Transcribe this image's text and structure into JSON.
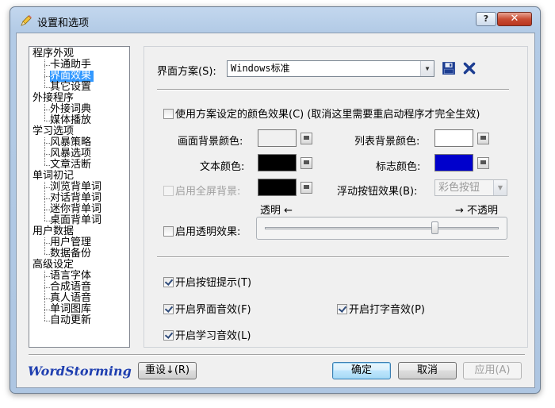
{
  "window": {
    "title": "设置和选项",
    "help_label": "?",
    "close_label": "✕"
  },
  "tree": {
    "items": [
      {
        "label": "程序外观",
        "level": 0
      },
      {
        "label": "卡通助手",
        "level": 1
      },
      {
        "label": "界面效果",
        "level": 1,
        "selected": true
      },
      {
        "label": "其它设置",
        "level": 1
      },
      {
        "label": "外接程序",
        "level": 0
      },
      {
        "label": "外接词典",
        "level": 1
      },
      {
        "label": "媒体播放",
        "level": 1
      },
      {
        "label": "学习选项",
        "level": 0
      },
      {
        "label": "风暴策略",
        "level": 1
      },
      {
        "label": "风暴选项",
        "level": 1
      },
      {
        "label": "文章活断",
        "level": 1
      },
      {
        "label": "单词初记",
        "level": 0
      },
      {
        "label": "浏览背单词",
        "level": 1
      },
      {
        "label": "对话背单词",
        "level": 1
      },
      {
        "label": "迷你背单词",
        "level": 1
      },
      {
        "label": "桌面背单词",
        "level": 1
      },
      {
        "label": "用户数据",
        "level": 0
      },
      {
        "label": "用户管理",
        "level": 1
      },
      {
        "label": "数据备份",
        "level": 1
      },
      {
        "label": "高级设定",
        "level": 0
      },
      {
        "label": "语言字体",
        "level": 1
      },
      {
        "label": "合成语音",
        "level": 1
      },
      {
        "label": "真人语音",
        "level": 1
      },
      {
        "label": "单词图库",
        "level": 1
      },
      {
        "label": "自动更新",
        "level": 1
      }
    ]
  },
  "panel": {
    "scheme_label": "界面方案(S):",
    "scheme_value": "Windows标准",
    "save_icon": "save-icon",
    "delete_icon": "delete-icon",
    "use_scheme_colors_label": "使用方案设定的颜色效果(C) (取消这里需要重启动程序才完全生效)",
    "use_scheme_colors_checked": false,
    "bg_color_label": "画面背景颜色:",
    "list_bg_color_label": "列表背景颜色:",
    "text_color_label": "文本颜色:",
    "mark_color_label": "标志颜色:",
    "fullscreen_bg_label": "启用全屏背景:",
    "fullscreen_bg_checked": false,
    "float_btn_label": "浮动按钮效果(B):",
    "float_btn_value": "彩色按钮",
    "transparent_label": "透明 ←",
    "opaque_label": "→ 不透明",
    "transparency_label": "启用透明效果:",
    "transparency_checked": false,
    "transparency_level": 0.73,
    "btn_tips_label": "开启按钮提示(T)",
    "btn_tips_checked": true,
    "ui_sound_label": "开启界面音效(F)",
    "ui_sound_checked": true,
    "typing_sound_label": "开启打字音效(P)",
    "typing_sound_checked": true,
    "study_sound_label": "开启学习音效(L)",
    "study_sound_checked": true
  },
  "colors": {
    "bg_color": "#f0f0f0",
    "list_bg_color": "#ffffff",
    "text_color": "#000000",
    "mark_color": "#0000cc",
    "fullscreen_bg_color": "#000000",
    "selection": "#3399ff",
    "brand": "#1f3fb0"
  },
  "footer": {
    "brand": "WordStorming",
    "reset_label": "重设↓(R)",
    "ok_label": "确定",
    "cancel_label": "取消",
    "apply_label": "应用(A)"
  }
}
